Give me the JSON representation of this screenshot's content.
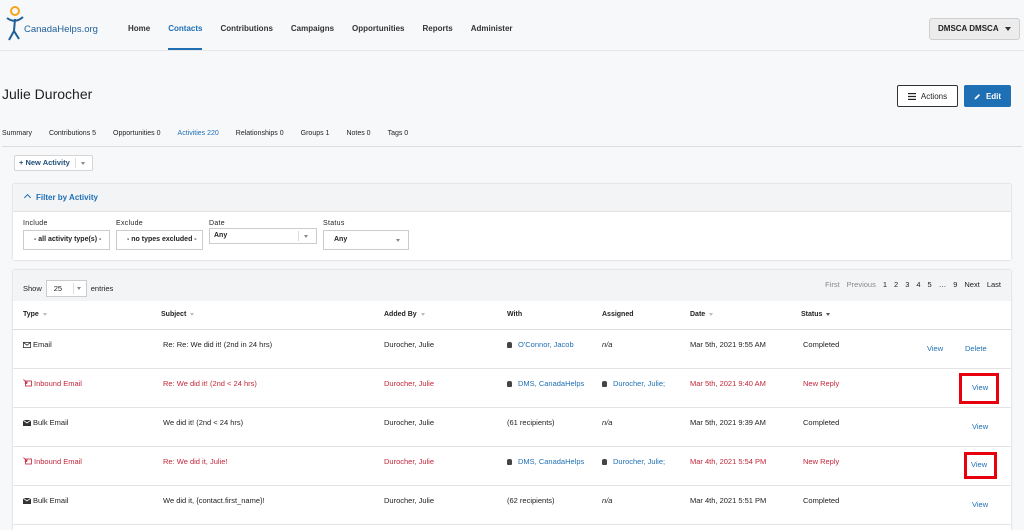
{
  "brand": {
    "name": "CanadaHelps.org",
    "accent": "#1f6fb5",
    "alert": "#c2263a",
    "highlight": "#e8000c"
  },
  "nav": {
    "items": [
      {
        "label": "Home"
      },
      {
        "label": "Contacts",
        "active": true
      },
      {
        "label": "Contributions"
      },
      {
        "label": "Campaigns"
      },
      {
        "label": "Opportunities"
      },
      {
        "label": "Reports"
      },
      {
        "label": "Administer"
      }
    ],
    "user": "DMSCA DMSCA"
  },
  "contact": {
    "name": "Julie Durocher",
    "actions_label": "Actions",
    "edit_label": "Edit"
  },
  "tabs": [
    {
      "label": "Summary"
    },
    {
      "label": "Contributions 5"
    },
    {
      "label": "Opportunities 0"
    },
    {
      "label": "Activities 220",
      "active": true
    },
    {
      "label": "Relationships 0"
    },
    {
      "label": "Groups 1"
    },
    {
      "label": "Notes 0"
    },
    {
      "label": "Tags 0"
    }
  ],
  "new_activity_label": "+ New Activity",
  "filter": {
    "title": "Filter by Activity",
    "include_label": "Include",
    "include_value": "- all activity type(s) -",
    "exclude_label": "Exclude",
    "exclude_value": "- no types excluded -",
    "date_label": "Date",
    "date_value": "Any",
    "status_label": "Status",
    "status_value": "Any"
  },
  "table": {
    "show_label": "Show",
    "show_value": "25",
    "entries_label": "entries",
    "pager": [
      "First",
      "Previous",
      "1",
      "2",
      "3",
      "4",
      "5",
      "…",
      "9",
      "Next",
      "Last"
    ],
    "headers": [
      "Type",
      "Subject",
      "Added By",
      "With",
      "Assigned",
      "Date",
      "Status"
    ],
    "rows": [
      {
        "type": "Email",
        "subject": "Re: Re: We did it! (2nd in 24 hrs)",
        "added_by": "Durocher, Julie",
        "with": "O'Connor, Jacob",
        "assigned": "n/a",
        "date": "Mar 5th, 2021 9:55 AM",
        "status": "Completed",
        "view": "View",
        "delete": "Delete",
        "alert": false
      },
      {
        "type": "Inbound Email",
        "subject": "Re: We did it! (2nd < 24 hrs)",
        "added_by": "Durocher, Julie",
        "with": "DMS, CanadaHelps",
        "assigned": "Durocher, Julie;",
        "date": "Mar 5th, 2021 9:40 AM",
        "status": "New Reply",
        "view": "View",
        "alert": true
      },
      {
        "type": "Bulk Email",
        "subject": "We did it! (2nd < 24 hrs)",
        "added_by": "Durocher, Julie",
        "with": "(61 recipients)",
        "assigned": "n/a",
        "date": "Mar 5th, 2021 9:39 AM",
        "status": "Completed",
        "view": "View",
        "alert": false
      },
      {
        "type": "Inbound Email",
        "subject": "Re: We did it, Julie!",
        "added_by": "Durocher, Julie",
        "with": "DMS, CanadaHelps",
        "assigned": "Durocher, Julie;",
        "date": "Mar 4th, 2021 5:54 PM",
        "status": "New Reply",
        "view": "View",
        "alert": true
      },
      {
        "type": "Bulk Email",
        "subject": "We did it, {contact.first_name}!",
        "added_by": "Durocher, Julie",
        "with": "(62 recipients)",
        "assigned": "n/a",
        "date": "Mar 4th, 2021 5:51 PM",
        "status": "Completed",
        "view": "View",
        "alert": false
      }
    ]
  }
}
